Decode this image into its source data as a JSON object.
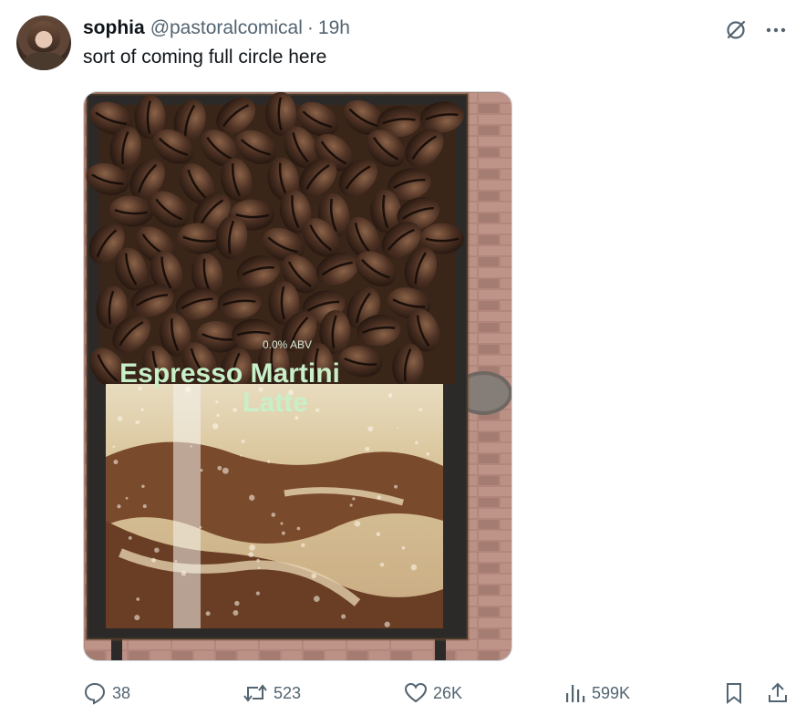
{
  "tweet": {
    "author": {
      "name": "sophia",
      "handle": "@pastoralcomical",
      "separator": "·",
      "time": "19h"
    },
    "text": "sort of coming full circle here",
    "media": {
      "abv_text": "0.0% ABV",
      "title_line1": "Espresso Martini",
      "title_line2": "Latte"
    },
    "actions": {
      "replies": "38",
      "reposts": "523",
      "likes": "26K",
      "views": "599K"
    },
    "top_icons": [
      "grok-icon",
      "more-icon"
    ],
    "bottom_icons": [
      "reply-icon",
      "repost-icon",
      "like-icon",
      "views-icon",
      "bookmark-icon",
      "share-icon"
    ]
  },
  "colors": {
    "secondary_text": "#536471",
    "primary_text": "#0f1419",
    "sign_title": "#c8f0c8",
    "border": "#cfd9de"
  }
}
